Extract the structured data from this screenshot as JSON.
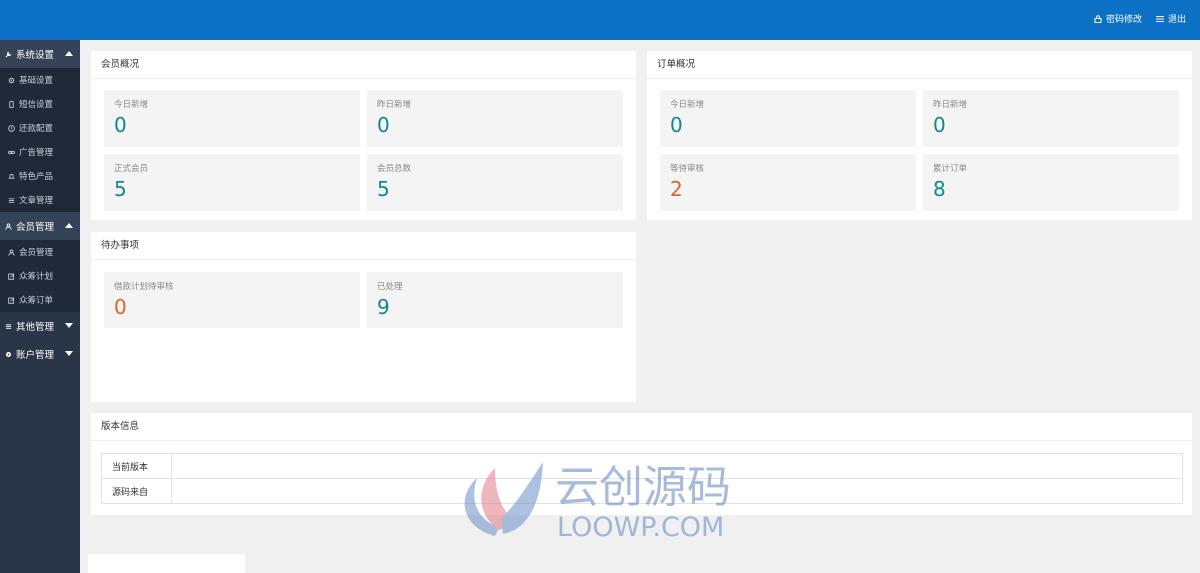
{
  "header": {
    "actions": [
      {
        "icon": "lock-icon",
        "label": "密码修改"
      },
      {
        "icon": "menu-icon",
        "label": "退出"
      }
    ]
  },
  "sidebar": {
    "groups": [
      {
        "label": "系统设置",
        "icon": "wrench-icon",
        "expanded": true,
        "items": [
          "基础设置",
          "短信设置",
          "还款配置",
          "广告管理",
          "特色产品",
          "文章管理"
        ]
      },
      {
        "label": "会员管理",
        "icon": "user-icon",
        "expanded": true,
        "items": [
          "会员管理",
          "众筹计划",
          "众筹订单"
        ]
      },
      {
        "label": "其他管理",
        "icon": "list-icon",
        "expanded": false,
        "items": []
      },
      {
        "label": "账户管理",
        "icon": "gear-icon",
        "expanded": false,
        "items": []
      }
    ]
  },
  "member_overview": {
    "title": "会员概况",
    "stats": [
      {
        "label": "今日新增",
        "value": "0"
      },
      {
        "label": "昨日新增",
        "value": "0"
      },
      {
        "label": "正式会员",
        "value": "5"
      },
      {
        "label": "会员总数",
        "value": "5"
      }
    ]
  },
  "order_overview": {
    "title": "订单概况",
    "stats": [
      {
        "label": "今日新增",
        "value": "0"
      },
      {
        "label": "昨日新增",
        "value": "0"
      },
      {
        "label": "等待审核",
        "value": "2"
      },
      {
        "label": "累计订单",
        "value": "8"
      }
    ]
  },
  "todo": {
    "title": "待办事项",
    "stats": [
      {
        "label": "借款计划待审核",
        "value": "0"
      },
      {
        "label": "已处理",
        "value": "9"
      }
    ]
  },
  "version_info": {
    "title": "版本信息",
    "rows": [
      {
        "key": "当前版本",
        "value": ""
      },
      {
        "key": "源码来自",
        "value": ""
      }
    ]
  },
  "watermark": {
    "cn": "云创源码",
    "en": "LOOWP.COM"
  },
  "colors": {
    "header": "#0c70c5",
    "sidebar": "#2a3547",
    "teal": "#0f8a8a",
    "orange": "#e3622b"
  }
}
